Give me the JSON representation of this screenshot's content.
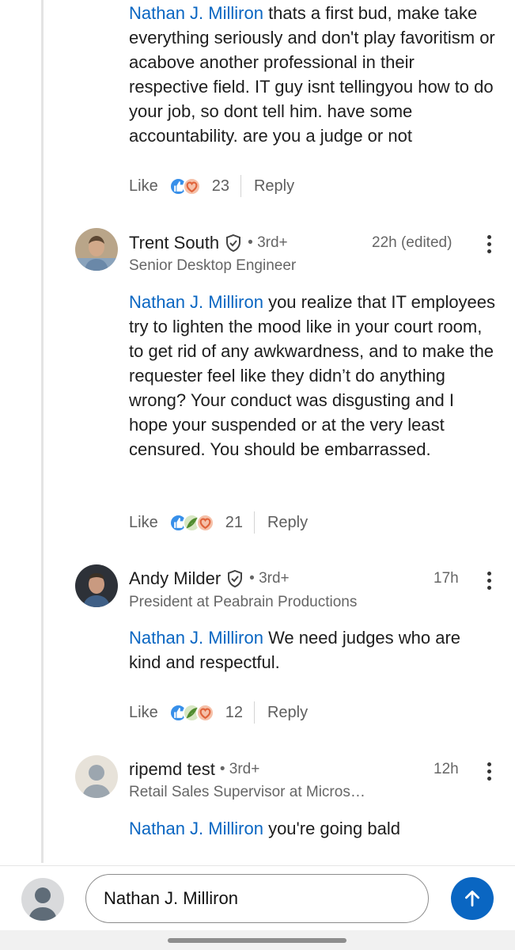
{
  "comments": [
    {
      "mention": "Nathan J. Milliron",
      "text": " thats a first bud, make take everything seriously and don't play favoritism or acabove another professional in their respective field. IT guy isnt tellingyou how to do your job, so dont tell him. have some accountability. are you a judge or not",
      "actions": {
        "like_label": "Like",
        "reaction_count": "23",
        "reply_label": "Reply"
      }
    },
    {
      "author": "Trent South",
      "degree": "• 3rd+",
      "headline": "Senior Desktop Engineer",
      "time": "22h (edited)",
      "mention": "Nathan J. Milliron",
      "text": " you realize that IT employees try to lighten the mood like in your court room, to get rid of any awkwardness, and to make the requester feel like they didn’t do anything wrong? Your conduct was disgusting and I hope your suspended or at the very least censured. You should be embarrassed.",
      "actions": {
        "like_label": "Like",
        "reaction_count": "21",
        "reply_label": "Reply"
      }
    },
    {
      "author": "Andy Milder",
      "degree": "• 3rd+",
      "headline": "President at Peabrain Productions",
      "time": "17h",
      "mention": "Nathan J. Milliron",
      "text": " We need judges who are kind and respectful.",
      "actions": {
        "like_label": "Like",
        "reaction_count": "12",
        "reply_label": "Reply"
      }
    },
    {
      "author": "ripemd test",
      "degree": "• 3rd+",
      "headline": "Retail Sales Supervisor at Micros…",
      "time": "12h",
      "mention": "Nathan J. Milliron",
      "text": " you're going bald"
    }
  ],
  "composer": {
    "value": "Nathan J. Milliron"
  },
  "icons": {
    "reactions": [
      "like-icon",
      "support-icon",
      "love-icon"
    ],
    "verified": "verified-shield-icon",
    "more": "more-vertical-icon",
    "send": "send-arrow-icon"
  },
  "colors": {
    "mention": "#0a66c2",
    "send_button": "#0a66c2",
    "like": "#378fe9",
    "love": "#e0633a",
    "support": "#4f8b2e"
  }
}
